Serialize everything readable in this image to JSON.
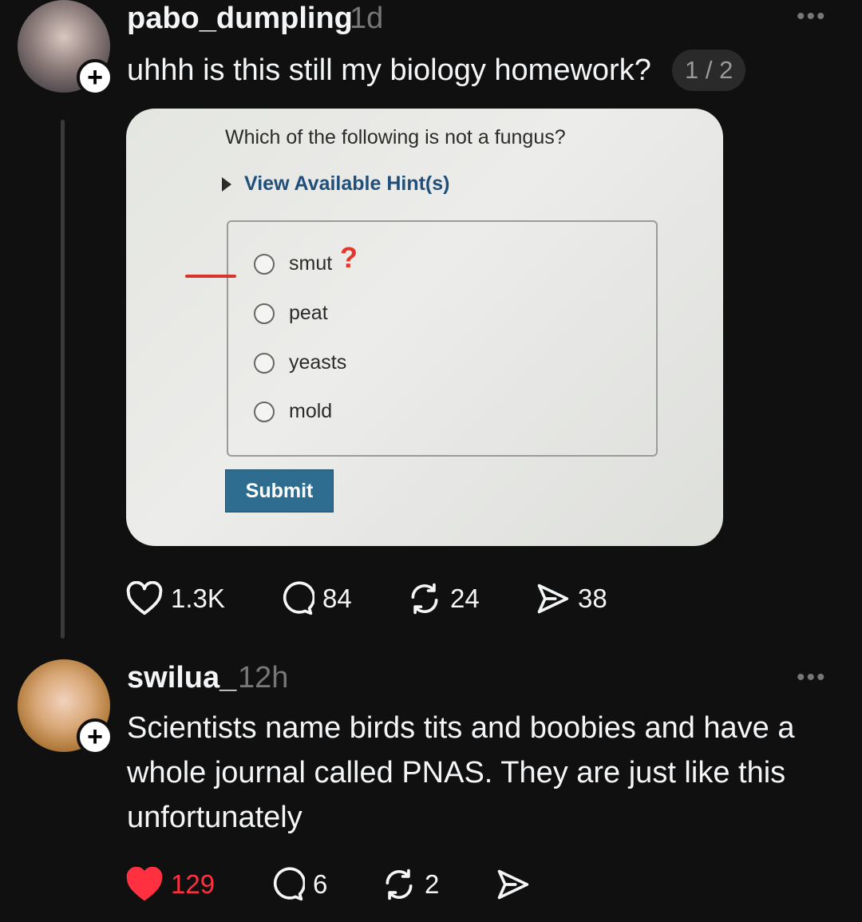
{
  "post1": {
    "username": "pabo_dumpling",
    "time": "1d",
    "text": "uhhh is this still my biology homework?",
    "image_counter": "1 / 2",
    "quiz": {
      "question": "Which of the following is not a fungus?",
      "hint_label": "View Available Hint(s)",
      "options": [
        "smut",
        "peat",
        "yeasts",
        "mold"
      ],
      "annotation": "?",
      "submit_label": "Submit"
    },
    "stats": {
      "likes": "1.3K",
      "replies": "84",
      "reposts": "24",
      "shares": "38"
    }
  },
  "post2": {
    "username": "swilua_",
    "time": "12h",
    "text_lines": [
      "Scientists name birds tits and boobies and have a",
      "whole journal called PNAS. They are just like this",
      "unfortunately"
    ],
    "stats": {
      "likes": "129",
      "replies": "6",
      "reposts": "2"
    }
  },
  "colors": {
    "background": "#101010",
    "liked": "#ff3040",
    "submit": "#2e6d8f"
  },
  "icons": [
    "plus-icon",
    "more-icon",
    "heart-icon",
    "comment-icon",
    "repost-icon",
    "share-icon"
  ]
}
